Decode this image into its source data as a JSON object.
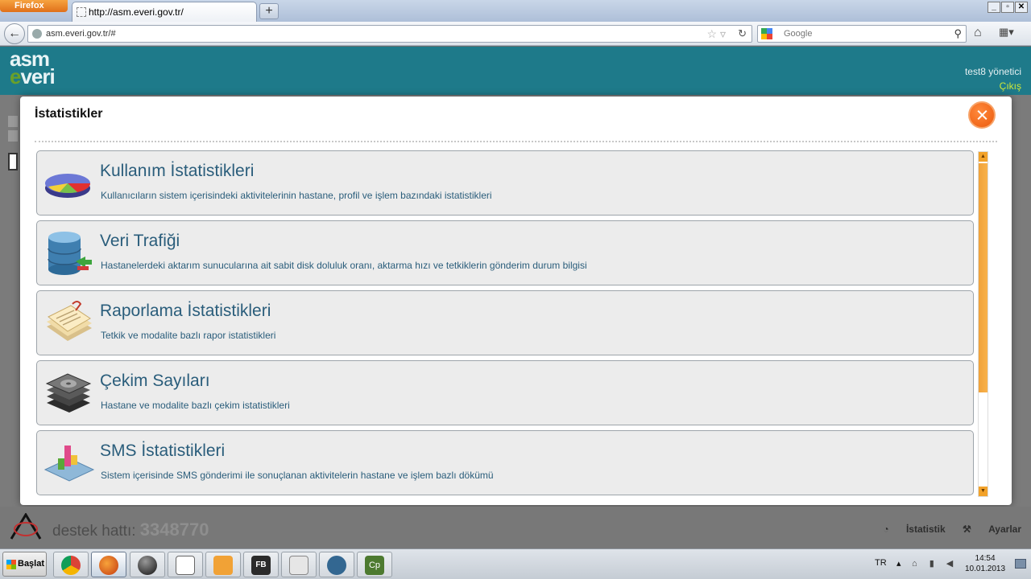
{
  "browser": {
    "menu_label": "Firefox",
    "tab_title": "http://asm.everi.gov.tr/",
    "new_tab": "+",
    "url": "asm.everi.gov.tr/#",
    "search_placeholder": "Google",
    "window_buttons": [
      "_",
      "▫",
      "✕"
    ]
  },
  "site": {
    "logo_line1": "asm",
    "logo_e": "e",
    "logo_line2": "veri",
    "user": "test8 yönetici",
    "logout": "Çıkış",
    "support_label": "destek hattı:",
    "support_number": "3348770",
    "footer_links": [
      "İstatistik",
      "Ayarlar"
    ]
  },
  "modal": {
    "title": "İstatistikler",
    "items": [
      {
        "title": "Kullanım İstatistikleri",
        "desc": "Kullanıcıların sistem içerisindeki aktivitelerinin hastane, profil ve işlem bazındaki istatistikleri",
        "icon": "pie-chart-icon"
      },
      {
        "title": "Veri Trafiği",
        "desc": "Hastanelerdeki aktarım sunucularına ait sabit disk doluluk oranı, aktarma hızı ve tetkiklerin gönderim durum bilgisi",
        "icon": "database-icon"
      },
      {
        "title": "Raporlama İstatistikleri",
        "desc": "Tetkik ve modalite bazlı rapor istatistikleri",
        "icon": "documents-icon"
      },
      {
        "title": "Çekim Sayıları",
        "desc": "Hastane ve modalite bazlı çekim istatistikleri",
        "icon": "disk-stack-icon"
      },
      {
        "title": "SMS İstatistikleri",
        "desc": "Sistem içerisinde SMS gönderimi ile sonuçlanan aktivitelerin hastane ve işlem bazlı dökümü",
        "icon": "bar-chart-icon"
      }
    ]
  },
  "taskbar": {
    "start_label": "Başlat",
    "language": "TR",
    "time": "14:54",
    "date": "10.01.2013"
  },
  "colors": {
    "header_teal": "#1e7a8a",
    "title_blue": "#2a5d7b",
    "close_orange": "#ec5a0c",
    "scroll_orange": "#f2a22a"
  }
}
